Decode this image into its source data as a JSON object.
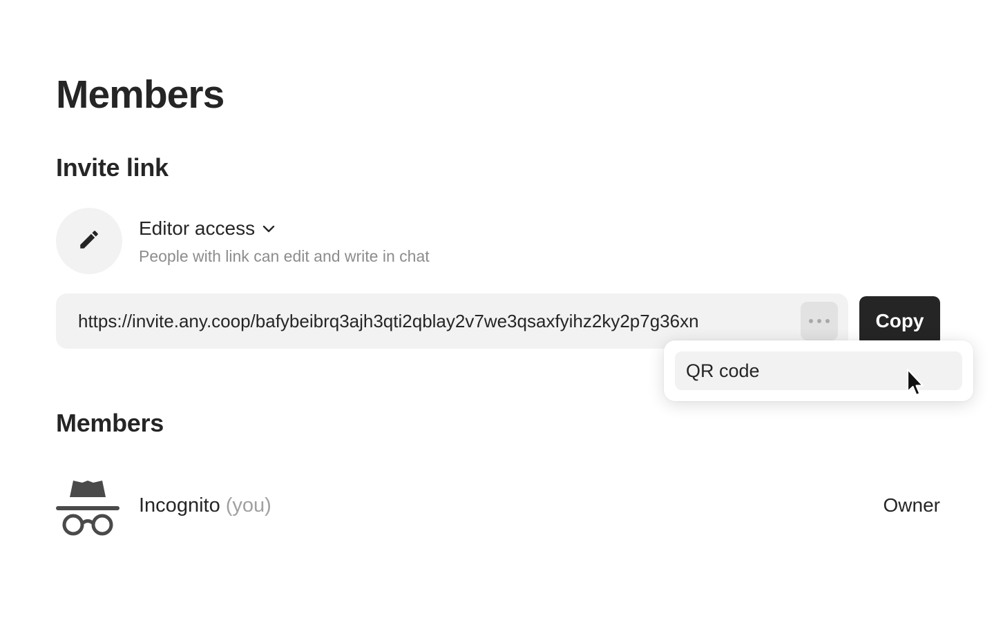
{
  "page": {
    "title": "Members"
  },
  "invite": {
    "section_title": "Invite link",
    "access_icon": "pencil-icon",
    "access_label": "Editor access",
    "access_description": "People with link can edit and write in chat",
    "link_url": "https://invite.any.coop/bafybeibrq3ajh3qti2qblay2v7we3qsaxfyihz2ky2p7g36xn",
    "more_icon": "more-dots-icon",
    "copy_label": "Copy"
  },
  "menu": {
    "items": [
      {
        "label": "QR code"
      }
    ]
  },
  "members": {
    "section_title": "Members",
    "list": [
      {
        "avatar_icon": "incognito-icon",
        "name": "Incognito",
        "you_suffix": "(you)",
        "role": "Owner"
      }
    ]
  },
  "colors": {
    "text": "#252525",
    "muted": "#8c8c8c",
    "surface": "#f2f2f2",
    "button_bg": "#252525",
    "button_text": "#ffffff"
  }
}
